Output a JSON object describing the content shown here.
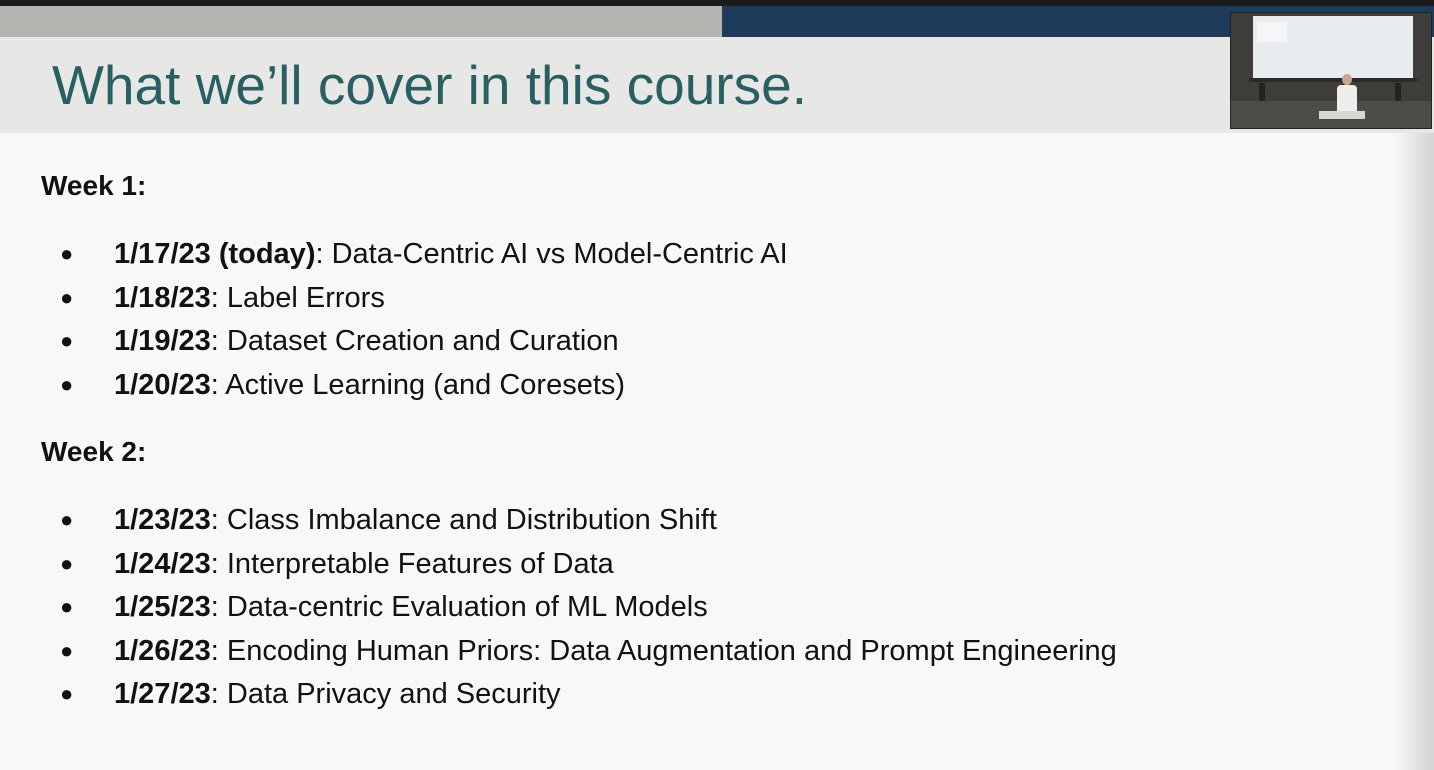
{
  "slide": {
    "title": "What we’ll cover in this course."
  },
  "weeks": [
    {
      "heading": "Week 1:",
      "items": [
        {
          "date": "1/17/23 (today)",
          "topic": ": Data-Centric AI vs Model-Centric AI"
        },
        {
          "date": "1/18/23",
          "topic": ": Label Errors"
        },
        {
          "date": "1/19/23",
          "topic": ": Dataset Creation and Curation"
        },
        {
          "date": "1/20/23",
          "topic": ": Active Learning (and Coresets)"
        }
      ]
    },
    {
      "heading": "Week 2:",
      "items": [
        {
          "date": "1/23/23",
          "topic": ": Class Imbalance and Distribution Shift"
        },
        {
          "date": "1/24/23",
          "topic": ": Interpretable Features of Data"
        },
        {
          "date": "1/25/23",
          "topic": ": Data-centric Evaluation of ML Models"
        },
        {
          "date": "1/26/23",
          "topic": ": Encoding Human Priors: Data Augmentation and Prompt Engineering"
        },
        {
          "date": "1/27/23",
          "topic": ": Data Privacy and Security"
        }
      ]
    }
  ],
  "colors": {
    "title": "#275f62",
    "accent_gray": "#b3b3b0",
    "accent_navy": "#1f3b5c",
    "title_band": "#e7e7e5",
    "text": "#111111"
  },
  "icons": {
    "bullet": "●"
  }
}
